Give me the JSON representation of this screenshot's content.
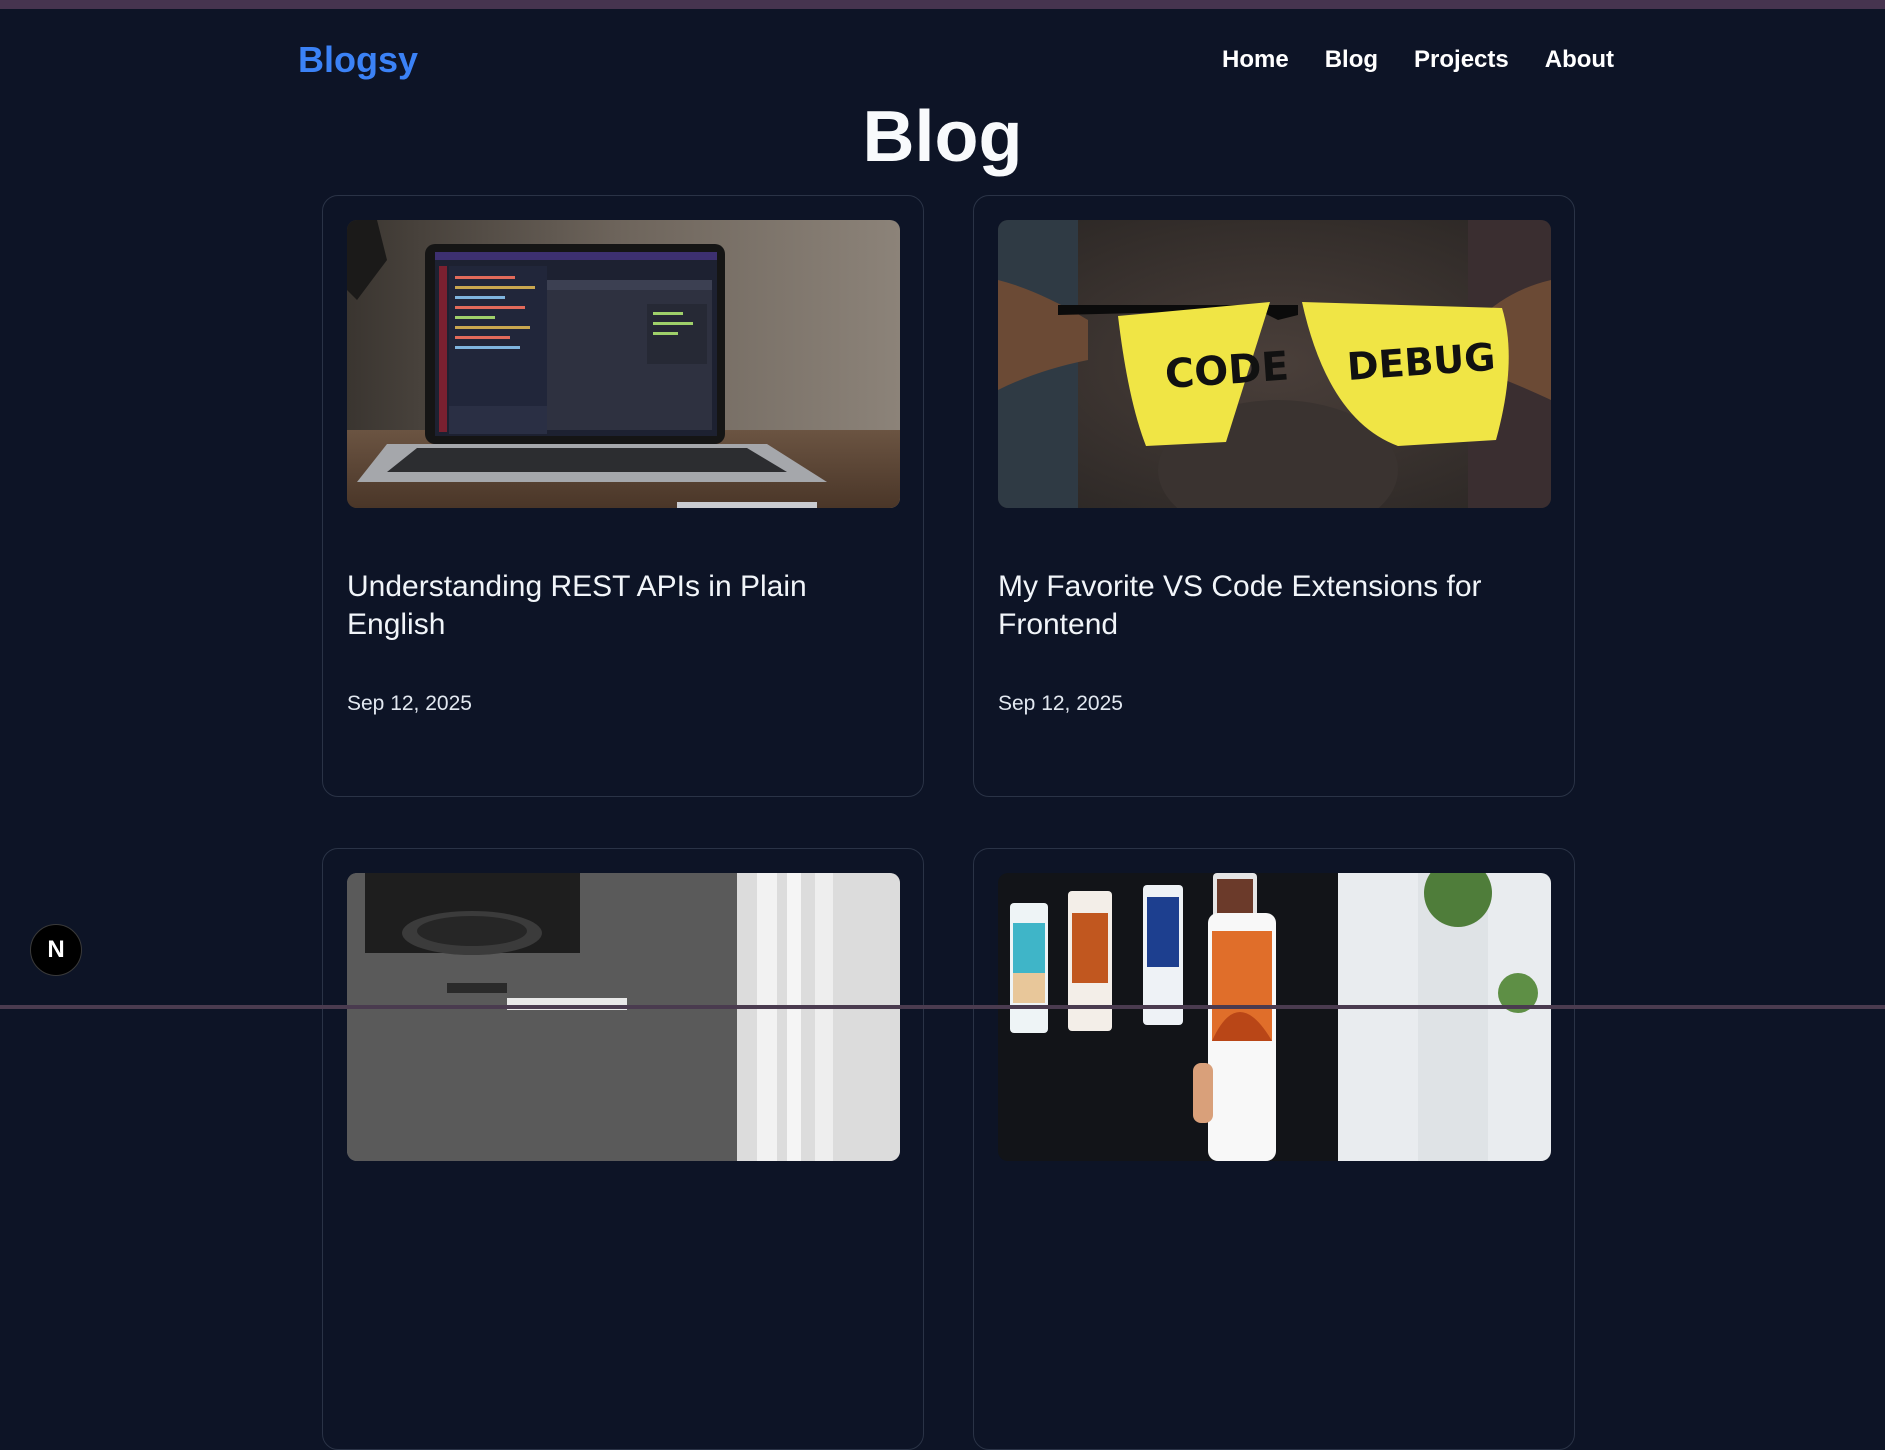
{
  "site": {
    "logo": "Blogsy"
  },
  "nav": {
    "items": [
      {
        "label": "Home"
      },
      {
        "label": "Blog"
      },
      {
        "label": "Projects"
      },
      {
        "label": "About"
      }
    ]
  },
  "page": {
    "title": "Blog"
  },
  "posts": [
    {
      "title": "Understanding REST APIs in Plain English",
      "date": "Sep 12, 2025",
      "image": "laptop-code-photo"
    },
    {
      "title": "My Favorite VS Code Extensions for Frontend",
      "date": "Sep 12, 2025",
      "image": "code-debug-glasses-photo",
      "image_text_left": "CODE",
      "image_text_right": "DEBUG"
    },
    {
      "title": "",
      "date": "",
      "image": "monochrome-room-photo"
    },
    {
      "title": "",
      "date": "",
      "image": "phone-app-screens-photo"
    }
  ],
  "dev_badge": {
    "label": "N",
    "icon": "nextjs-icon"
  },
  "colors": {
    "background": "#0d1426",
    "accent": "#3b82f6",
    "card_border": "#2a3346"
  }
}
